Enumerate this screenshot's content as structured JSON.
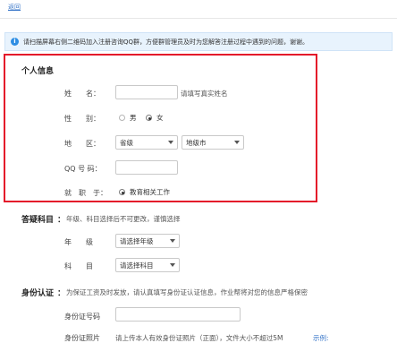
{
  "top": {
    "back_label": "返回"
  },
  "notice": {
    "text": "请扫描屏幕右侧二维码加入注册咨询QQ群，方便群管理员及时为您解答注册过程中遇到的问题，谢谢。"
  },
  "personal": {
    "title": "个人信息",
    "name_label": "姓　　名：",
    "name_value": "",
    "name_hint": "请填写真实姓名",
    "gender_label": "性　　别：",
    "gender_male": "男",
    "gender_female": "女",
    "gender_selected": "女",
    "region_label": "地　　区：",
    "province_value": "省级",
    "city_value": "地级市",
    "qq_label": "QQ 号 码：",
    "qq_value": "",
    "job_label": "就　职　于：",
    "job_option": "教育相关工作"
  },
  "subject": {
    "title": "答疑科目",
    "note": "年级、科目选择后不可更改，谨慎选择",
    "grade_label": "年　　级",
    "grade_value": "请选择年级",
    "subject_label": "科　　目",
    "subject_value": "请选择科目"
  },
  "identity": {
    "title": "身份认证",
    "note": "为保证工资及时发放，请认真填写身份证认证信息，作业帮将对您的信息严格保密",
    "id_label": "身份证号码",
    "id_value": "",
    "photo_label": "身份证照片",
    "photo_hint": "请上传本人有效身份证照片（正面），文件大小不超过5M",
    "example_link": "示例:"
  }
}
